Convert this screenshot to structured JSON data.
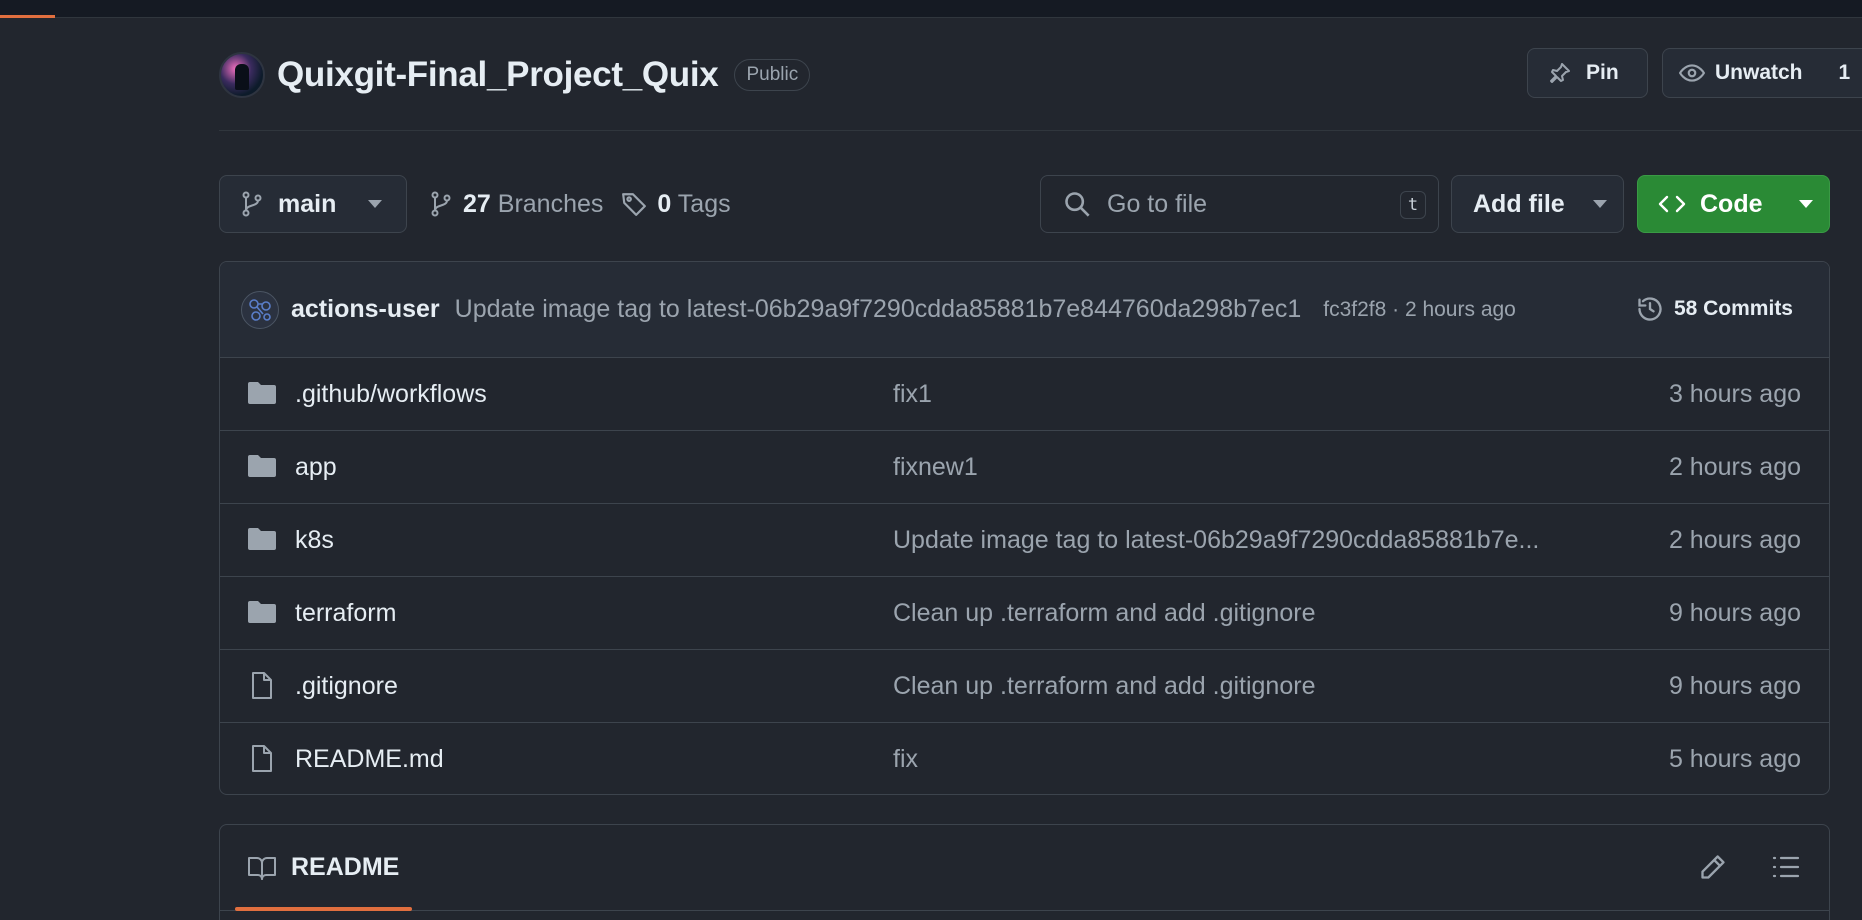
{
  "repo": {
    "name": "Quixgit-Final_Project_Quix",
    "visibility": "Public",
    "pin_label": "Pin",
    "unwatch_label": "Unwatch",
    "watch_count": "1"
  },
  "toolbar": {
    "branch": "main",
    "branches_count": "27",
    "branches_label": "Branches",
    "tags_count": "0",
    "tags_label": "Tags",
    "goto_placeholder": "Go to file",
    "goto_shortcut": "t",
    "add_file_label": "Add file",
    "code_label": "Code"
  },
  "latest_commit": {
    "user": "actions-user",
    "message": "Update image tag to latest-06b29a9f7290cdda85881b7e844760da298b7ec1",
    "hash_time": "fc3f2f8 · 2 hours ago",
    "commits_label": "58 Commits"
  },
  "files": [
    {
      "type": "folder",
      "name": ".github/workflows",
      "message": "fix1",
      "age": "3 hours ago"
    },
    {
      "type": "folder",
      "name": "app",
      "message": "fixnew1",
      "age": "2 hours ago"
    },
    {
      "type": "folder",
      "name": "k8s",
      "message": "Update image tag to latest-06b29a9f7290cdda85881b7e...",
      "age": "2 hours ago"
    },
    {
      "type": "folder",
      "name": "terraform",
      "message": "Clean up .terraform and add .gitignore",
      "age": "9 hours ago"
    },
    {
      "type": "file",
      "name": ".gitignore",
      "message": "Clean up .terraform and add .gitignore",
      "age": "9 hours ago"
    },
    {
      "type": "file",
      "name": "README.md",
      "message": "fix",
      "age": "5 hours ago"
    }
  ],
  "readme": {
    "tab_label": "README"
  },
  "colors": {
    "accent": "#e16f3f",
    "code_button": "#2a8a35",
    "background": "#22262e"
  }
}
